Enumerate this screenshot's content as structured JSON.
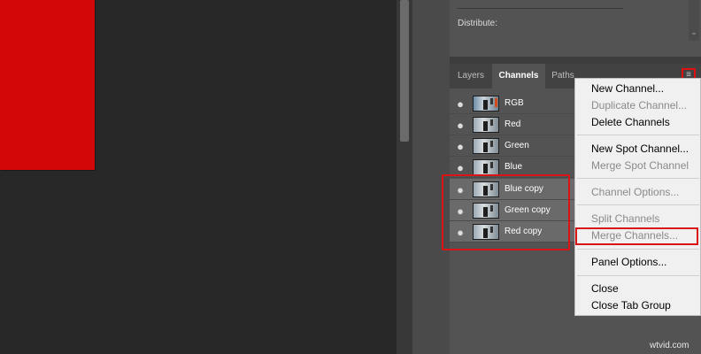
{
  "properties": {
    "distribute_label": "Distribute:"
  },
  "tabs": [
    {
      "label": "Layers",
      "active": false
    },
    {
      "label": "Channels",
      "active": true
    },
    {
      "label": "Paths",
      "active": false
    }
  ],
  "panel_menu_icon": "hamburger-icon",
  "channels": [
    {
      "label": "RGB",
      "thumb": "rgb"
    },
    {
      "label": "Red",
      "thumb": "gray"
    },
    {
      "label": "Green",
      "thumb": "gray"
    },
    {
      "label": "Blue",
      "thumb": "gray"
    },
    {
      "label": "Blue copy",
      "thumb": "gray"
    },
    {
      "label": "Green copy",
      "thumb": "gray"
    },
    {
      "label": "Red copy",
      "thumb": "gray"
    }
  ],
  "menu": {
    "new_channel": "New Channel...",
    "duplicate_channel": "Duplicate Channel...",
    "delete_channels": "Delete Channels",
    "new_spot_channel": "New Spot Channel...",
    "merge_spot_channel": "Merge Spot Channel",
    "channel_options": "Channel Options...",
    "split_channels": "Split Channels",
    "merge_channels": "Merge Channels...",
    "panel_options": "Panel Options...",
    "close": "Close",
    "close_tab_group": "Close Tab Group"
  },
  "watermark": "wtvid.com",
  "colors": {
    "document_red": "#d30707",
    "highlight_red": "#d81414",
    "panel_gray": "#535353"
  }
}
